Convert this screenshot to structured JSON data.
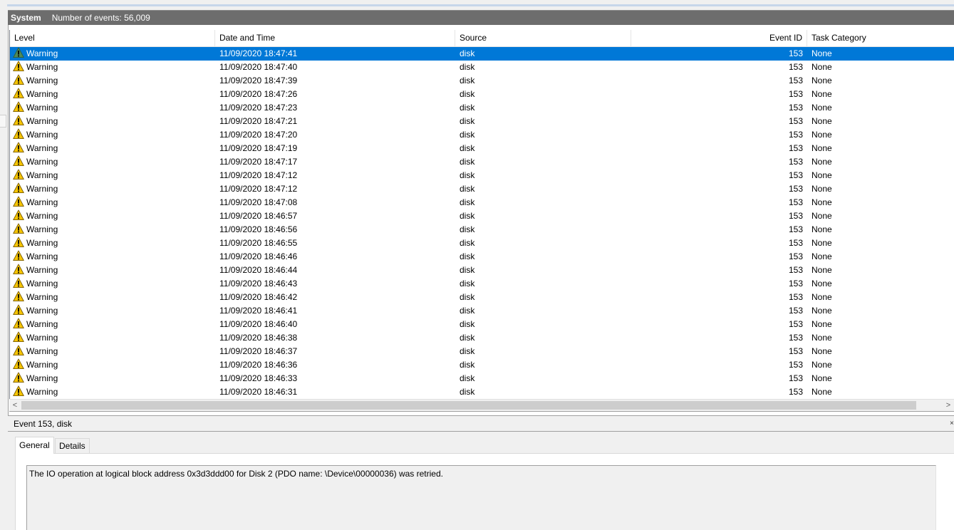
{
  "header": {
    "log_name": "System",
    "event_count": "Number of events: 56,009"
  },
  "columns": {
    "level": "Level",
    "date_time": "Date and Time",
    "source": "Source",
    "event_id": "Event ID",
    "task_category": "Task Category"
  },
  "colors": {
    "selection": "#0078d7",
    "title_bar": "#6d6d6d",
    "warning": "#f5c400"
  },
  "events": [
    {
      "level": "Warning",
      "date": "11/09/2020 18:47:41",
      "source": "disk",
      "event_id": "153",
      "category": "None",
      "selected": true
    },
    {
      "level": "Warning",
      "date": "11/09/2020 18:47:40",
      "source": "disk",
      "event_id": "153",
      "category": "None"
    },
    {
      "level": "Warning",
      "date": "11/09/2020 18:47:39",
      "source": "disk",
      "event_id": "153",
      "category": "None"
    },
    {
      "level": "Warning",
      "date": "11/09/2020 18:47:26",
      "source": "disk",
      "event_id": "153",
      "category": "None"
    },
    {
      "level": "Warning",
      "date": "11/09/2020 18:47:23",
      "source": "disk",
      "event_id": "153",
      "category": "None"
    },
    {
      "level": "Warning",
      "date": "11/09/2020 18:47:21",
      "source": "disk",
      "event_id": "153",
      "category": "None"
    },
    {
      "level": "Warning",
      "date": "11/09/2020 18:47:20",
      "source": "disk",
      "event_id": "153",
      "category": "None"
    },
    {
      "level": "Warning",
      "date": "11/09/2020 18:47:19",
      "source": "disk",
      "event_id": "153",
      "category": "None"
    },
    {
      "level": "Warning",
      "date": "11/09/2020 18:47:17",
      "source": "disk",
      "event_id": "153",
      "category": "None"
    },
    {
      "level": "Warning",
      "date": "11/09/2020 18:47:12",
      "source": "disk",
      "event_id": "153",
      "category": "None"
    },
    {
      "level": "Warning",
      "date": "11/09/2020 18:47:12",
      "source": "disk",
      "event_id": "153",
      "category": "None"
    },
    {
      "level": "Warning",
      "date": "11/09/2020 18:47:08",
      "source": "disk",
      "event_id": "153",
      "category": "None"
    },
    {
      "level": "Warning",
      "date": "11/09/2020 18:46:57",
      "source": "disk",
      "event_id": "153",
      "category": "None"
    },
    {
      "level": "Warning",
      "date": "11/09/2020 18:46:56",
      "source": "disk",
      "event_id": "153",
      "category": "None"
    },
    {
      "level": "Warning",
      "date": "11/09/2020 18:46:55",
      "source": "disk",
      "event_id": "153",
      "category": "None"
    },
    {
      "level": "Warning",
      "date": "11/09/2020 18:46:46",
      "source": "disk",
      "event_id": "153",
      "category": "None"
    },
    {
      "level": "Warning",
      "date": "11/09/2020 18:46:44",
      "source": "disk",
      "event_id": "153",
      "category": "None"
    },
    {
      "level": "Warning",
      "date": "11/09/2020 18:46:43",
      "source": "disk",
      "event_id": "153",
      "category": "None"
    },
    {
      "level": "Warning",
      "date": "11/09/2020 18:46:42",
      "source": "disk",
      "event_id": "153",
      "category": "None"
    },
    {
      "level": "Warning",
      "date": "11/09/2020 18:46:41",
      "source": "disk",
      "event_id": "153",
      "category": "None"
    },
    {
      "level": "Warning",
      "date": "11/09/2020 18:46:40",
      "source": "disk",
      "event_id": "153",
      "category": "None"
    },
    {
      "level": "Warning",
      "date": "11/09/2020 18:46:38",
      "source": "disk",
      "event_id": "153",
      "category": "None"
    },
    {
      "level": "Warning",
      "date": "11/09/2020 18:46:37",
      "source": "disk",
      "event_id": "153",
      "category": "None"
    },
    {
      "level": "Warning",
      "date": "11/09/2020 18:46:36",
      "source": "disk",
      "event_id": "153",
      "category": "None"
    },
    {
      "level": "Warning",
      "date": "11/09/2020 18:46:33",
      "source": "disk",
      "event_id": "153",
      "category": "None"
    },
    {
      "level": "Warning",
      "date": "11/09/2020 18:46:31",
      "source": "disk",
      "event_id": "153",
      "category": "None"
    }
  ],
  "scrollbar": {
    "left_arrow": "<",
    "right_arrow": ">"
  },
  "details": {
    "title": "Event 153, disk",
    "close_glyph": "×",
    "tabs": [
      "General",
      "Details"
    ],
    "message": "The IO operation at logical block address 0x3d3ddd00 for Disk 2 (PDO name: \\Device\\00000036) was retried."
  }
}
